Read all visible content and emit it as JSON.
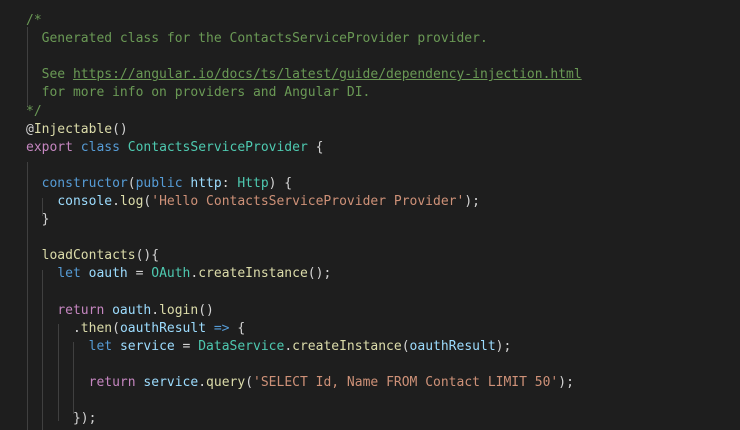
{
  "editor": {
    "language": "TypeScript",
    "colors": {
      "background": "#1e1e1e",
      "comment": "#6a9955",
      "keyword": "#569cd6",
      "control": "#c586c0",
      "type": "#4ec9b0",
      "function": "#dcdcaa",
      "variable": "#9cdcfe",
      "string": "#ce9178",
      "number": "#b5cea8",
      "text": "#d4d4d4"
    },
    "lines": [
      {
        "tokens": [
          {
            "t": "/*",
            "k": "c"
          }
        ]
      },
      {
        "tokens": [
          {
            "t": "  Generated class for the ContactsServiceProvider provider.",
            "k": "c"
          }
        ]
      },
      {
        "tokens": []
      },
      {
        "tokens": [
          {
            "t": "  See ",
            "k": "c"
          },
          {
            "t": "https://angular.io/docs/ts/latest/guide/dependency-injection.html",
            "k": "link",
            "link": true
          }
        ]
      },
      {
        "tokens": [
          {
            "t": "  for more info on providers and Angular DI.",
            "k": "c"
          }
        ]
      },
      {
        "tokens": [
          {
            "t": "*/",
            "k": "c"
          }
        ]
      },
      {
        "tokens": [
          {
            "t": "@",
            "k": "p"
          },
          {
            "t": "Injectable",
            "k": "fn"
          },
          {
            "t": "()",
            "k": "p"
          }
        ]
      },
      {
        "tokens": [
          {
            "t": "export",
            "k": "ctl"
          },
          {
            "t": " ",
            "k": "p"
          },
          {
            "t": "class",
            "k": "kw"
          },
          {
            "t": " ",
            "k": "p"
          },
          {
            "t": "ContactsServiceProvider",
            "k": "cls"
          },
          {
            "t": " {",
            "k": "p"
          }
        ]
      },
      {
        "tokens": []
      },
      {
        "tokens": [
          {
            "t": "  ",
            "k": "p"
          },
          {
            "t": "constructor",
            "k": "kw"
          },
          {
            "t": "(",
            "k": "p"
          },
          {
            "t": "public",
            "k": "kw"
          },
          {
            "t": " ",
            "k": "p"
          },
          {
            "t": "http",
            "k": "v"
          },
          {
            "t": ": ",
            "k": "p"
          },
          {
            "t": "Http",
            "k": "cls"
          },
          {
            "t": ") {",
            "k": "p"
          }
        ]
      },
      {
        "tokens": [
          {
            "t": "    ",
            "k": "p"
          },
          {
            "t": "console",
            "k": "v"
          },
          {
            "t": ".",
            "k": "p"
          },
          {
            "t": "log",
            "k": "fn"
          },
          {
            "t": "(",
            "k": "p"
          },
          {
            "t": "'Hello ContactsServiceProvider Provider'",
            "k": "str"
          },
          {
            "t": ");",
            "k": "p"
          }
        ]
      },
      {
        "tokens": [
          {
            "t": "  }",
            "k": "p"
          }
        ]
      },
      {
        "tokens": []
      },
      {
        "tokens": [
          {
            "t": "  ",
            "k": "p"
          },
          {
            "t": "loadContacts",
            "k": "fn"
          },
          {
            "t": "(){",
            "k": "p"
          }
        ]
      },
      {
        "tokens": [
          {
            "t": "    ",
            "k": "p"
          },
          {
            "t": "let",
            "k": "kw"
          },
          {
            "t": " ",
            "k": "p"
          },
          {
            "t": "oauth",
            "k": "v"
          },
          {
            "t": " = ",
            "k": "p"
          },
          {
            "t": "OAuth",
            "k": "cls"
          },
          {
            "t": ".",
            "k": "p"
          },
          {
            "t": "createInstance",
            "k": "fn"
          },
          {
            "t": "();",
            "k": "p"
          }
        ]
      },
      {
        "tokens": []
      },
      {
        "tokens": [
          {
            "t": "    ",
            "k": "p"
          },
          {
            "t": "return",
            "k": "ctl"
          },
          {
            "t": " ",
            "k": "p"
          },
          {
            "t": "oauth",
            "k": "v"
          },
          {
            "t": ".",
            "k": "p"
          },
          {
            "t": "login",
            "k": "fn"
          },
          {
            "t": "()",
            "k": "p"
          }
        ]
      },
      {
        "tokens": [
          {
            "t": "      .",
            "k": "p"
          },
          {
            "t": "then",
            "k": "fn"
          },
          {
            "t": "(",
            "k": "p"
          },
          {
            "t": "oauthResult",
            "k": "v"
          },
          {
            "t": " ",
            "k": "p"
          },
          {
            "t": "=>",
            "k": "kw"
          },
          {
            "t": " {",
            "k": "p"
          }
        ]
      },
      {
        "tokens": [
          {
            "t": "        ",
            "k": "p"
          },
          {
            "t": "let",
            "k": "kw"
          },
          {
            "t": " ",
            "k": "p"
          },
          {
            "t": "service",
            "k": "v"
          },
          {
            "t": " = ",
            "k": "p"
          },
          {
            "t": "DataService",
            "k": "cls"
          },
          {
            "t": ".",
            "k": "p"
          },
          {
            "t": "createInstance",
            "k": "fn"
          },
          {
            "t": "(",
            "k": "p"
          },
          {
            "t": "oauthResult",
            "k": "v"
          },
          {
            "t": ");",
            "k": "p"
          }
        ]
      },
      {
        "tokens": []
      },
      {
        "tokens": [
          {
            "t": "        ",
            "k": "p"
          },
          {
            "t": "return",
            "k": "ctl"
          },
          {
            "t": " ",
            "k": "p"
          },
          {
            "t": "service",
            "k": "v"
          },
          {
            "t": ".",
            "k": "p"
          },
          {
            "t": "query",
            "k": "fn"
          },
          {
            "t": "(",
            "k": "p"
          },
          {
            "t": "'SELECT Id, Name FROM Contact LIMIT 50'",
            "k": "str"
          },
          {
            "t": ");",
            "k": "p"
          }
        ]
      },
      {
        "tokens": []
      },
      {
        "tokens": [
          {
            "t": "      });",
            "k": "p"
          }
        ]
      }
    ]
  }
}
